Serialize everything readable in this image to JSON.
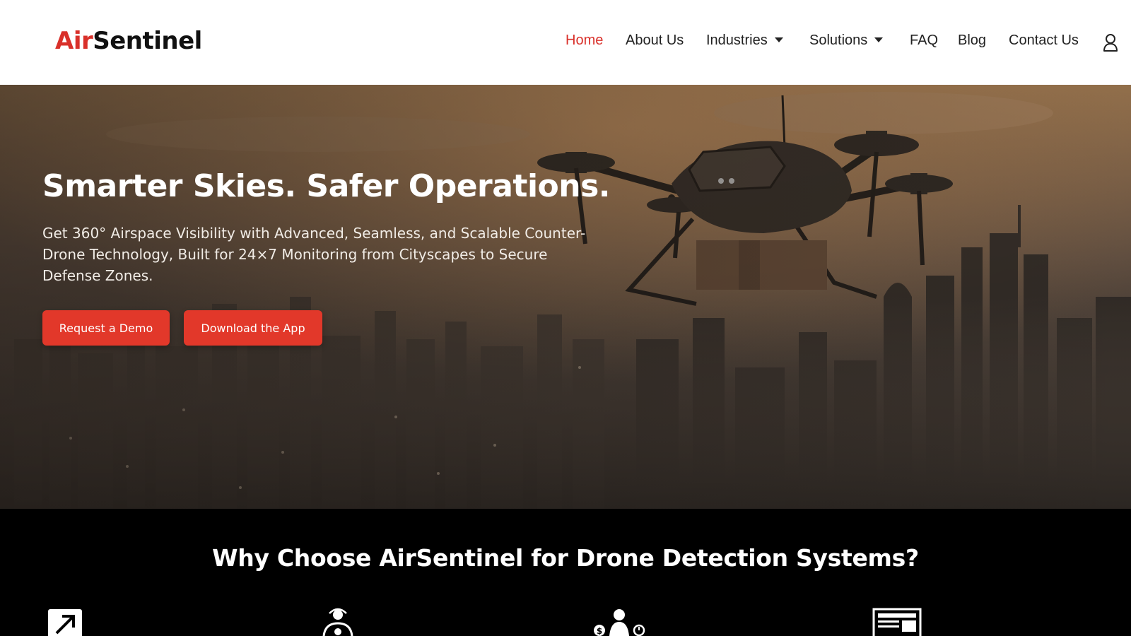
{
  "brand": {
    "part1": "Air",
    "part2": "Sentinel",
    "accent": "#d9302a"
  },
  "nav": {
    "items": [
      {
        "label": "Home",
        "active": true
      },
      {
        "label": "About Us"
      },
      {
        "label": "Industries",
        "dropdown": true
      },
      {
        "label": "Solutions",
        "dropdown": true
      },
      {
        "label": "FAQ"
      },
      {
        "label": "Blog"
      },
      {
        "label": "Contact Us"
      }
    ],
    "account_icon": "user-icon"
  },
  "hero": {
    "title": "Smarter Skies. Safer Operations.",
    "subtitle": "Get 360° Airspace Visibility with Advanced, Seamless, and Scalable Counter-Drone Technology, Built for 24×7 Monitoring from Cityscapes to Secure Defense Zones.",
    "buttons": {
      "demo": "Request a Demo",
      "app": "Download the App"
    },
    "button_color": "#e2382a"
  },
  "why": {
    "title": "Why Choose AirSentinel for Drone Detection Systems?",
    "feature_icons": [
      "scalability-arrow-icon",
      "support-agent-icon",
      "cost-time-savings-icon",
      "dashboard-monitor-icon"
    ]
  }
}
